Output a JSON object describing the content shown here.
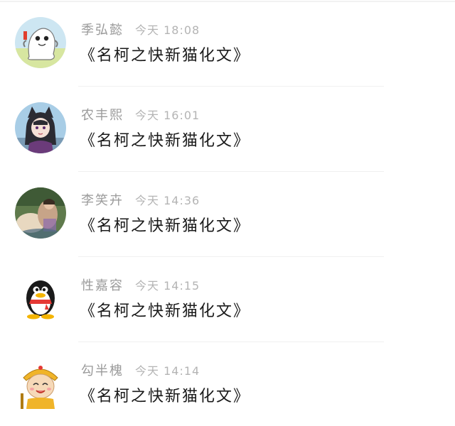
{
  "comments": [
    {
      "name": "季弘懿",
      "time": "今天 18:08",
      "content": "《名柯之快新猫化文》",
      "avatar_icon": "ghost-cat-icon"
    },
    {
      "name": "农丰熙",
      "time": "今天 16:01",
      "content": "《名柯之快新猫化文》",
      "avatar_icon": "anime-catgirl-icon"
    },
    {
      "name": "李笑卉",
      "time": "今天 14:36",
      "content": "《名柯之快新猫化文》",
      "avatar_icon": "photo-avatar-icon"
    },
    {
      "name": "性嘉容",
      "time": "今天 14:15",
      "content": "《名柯之快新猫化文》",
      "avatar_icon": "qq-penguin-icon"
    },
    {
      "name": "勾半槐",
      "time": "今天 14:14",
      "content": "《名柯之快新猫化文》",
      "avatar_icon": "monkey-king-icon"
    }
  ],
  "colors": {
    "name": "#9b9b9b",
    "time": "#b4b4b4",
    "content": "#1a1a1a",
    "divider": "#f0f0f0"
  }
}
